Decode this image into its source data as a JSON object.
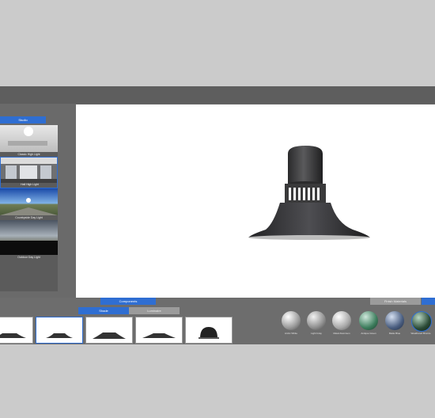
{
  "left_panel": {
    "tab_label": "Studio",
    "environments": [
      {
        "name": "Classic High Light"
      },
      {
        "name": "Hall High Light"
      },
      {
        "name": "Countryside Day Light"
      },
      {
        "name": "Outdoor Day Light"
      }
    ]
  },
  "bottom_bar": {
    "components_label": "Components",
    "finish_materials_label": "Finish Materials",
    "subtabs": [
      "Shade",
      "Luminaire"
    ],
    "materials": [
      {
        "name": "Arctic White"
      },
      {
        "name": "Light Gray"
      },
      {
        "name": "Metal Aluminum"
      },
      {
        "name": "Antique Green"
      },
      {
        "name": "Matte Blue"
      },
      {
        "name": "Weathered Bronze"
      }
    ]
  }
}
